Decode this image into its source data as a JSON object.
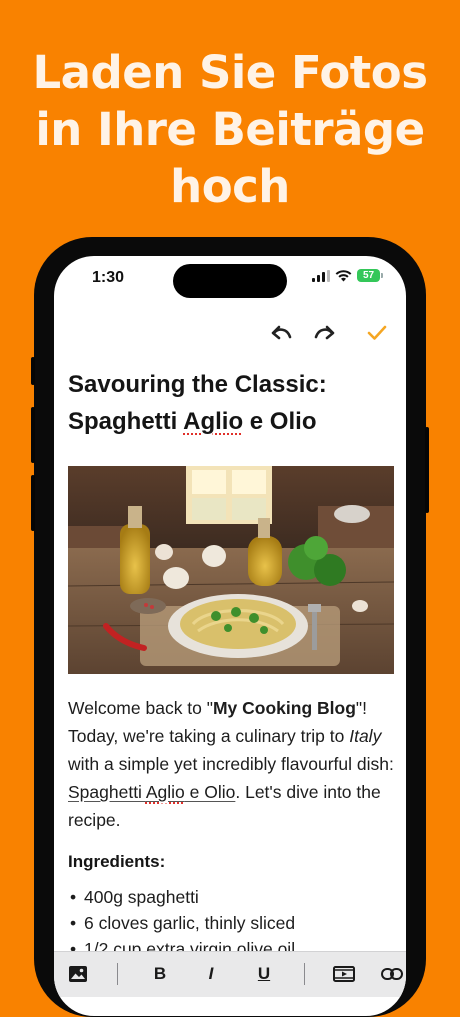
{
  "promo": {
    "title_lines": [
      "Laden Sie Fotos",
      "in Ihre Beiträge",
      "hoch"
    ]
  },
  "status_bar": {
    "time": "1:30",
    "battery": "57"
  },
  "editor_toolbar": {
    "undo_icon": "undo-icon",
    "redo_icon": "redo-icon",
    "done_icon": "checkmark-icon"
  },
  "post": {
    "title_line1": "Savouring the Classic:",
    "title_line2_pre": "Spaghetti ",
    "title_line2_misspelled": "Aglio",
    "title_line2_post": " e Olio",
    "image_subject": "spaghetti aglio e olio with olive oil, garlic and parsley on a rustic kitchen table",
    "paragraph": {
      "p1": "Welcome back to \"",
      "bold": "My Cooking Blog",
      "p2": "\"! Today, we're taking a culinary trip to ",
      "italic": "Italy",
      "p3": " with a simple yet incredibly flavourful dish: ",
      "link_pre": "Spaghetti ",
      "link_misspelled": "Aglio",
      "link_post": " e Olio",
      "p4": ". Let's dive into the recipe."
    },
    "ingredients_heading": "Ingredients:",
    "ingredients": [
      "400g spaghetti",
      "6 cloves garlic, thinly sliced",
      "1/2 cup extra virgin olive oil"
    ]
  },
  "format_bar": {
    "image_icon": "image-icon",
    "bold": "B",
    "italic": "I",
    "underline": "U",
    "video_icon": "video-icon",
    "link_icon": "link-icon"
  },
  "colors": {
    "background": "#f98200",
    "accent": "#f5a623",
    "promo_text": "#fff3e6",
    "battery": "#34c759"
  }
}
